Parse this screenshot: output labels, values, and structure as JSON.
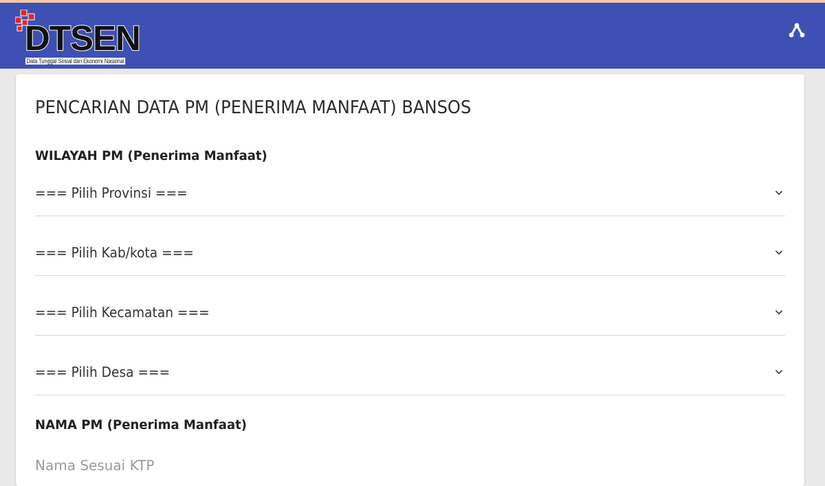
{
  "header": {
    "logo_text": "DTSEN",
    "logo_subtitle": "Data Tunggal Sosial dan Ekonomi Nasional",
    "background_color": "#3e50b4",
    "share_icon": "share-icon"
  },
  "form": {
    "title": "PENCARIAN DATA PM (PENERIMA MANFAAT) BANSOS",
    "region_heading": "WILAYAH PM (Penerima Manfaat)",
    "selects": [
      {
        "label": "=== Pilih Provinsi ==="
      },
      {
        "label": "=== Pilih Kab/kota ==="
      },
      {
        "label": "=== Pilih Kecamatan ==="
      },
      {
        "label": "=== Pilih Desa ==="
      }
    ],
    "name_heading": "NAMA PM (Penerima Manfaat)",
    "name_placeholder": "Nama Sesuai KTP"
  }
}
